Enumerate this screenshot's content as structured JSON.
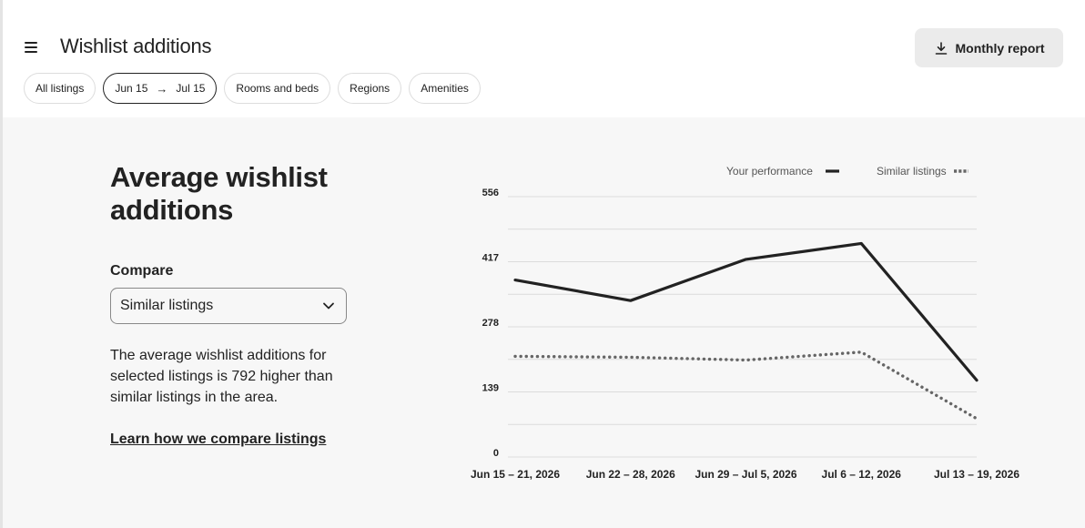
{
  "header": {
    "title": "Wishlist additions",
    "report_button": "Monthly report"
  },
  "filters": {
    "all_listings": "All listings",
    "date_from": "Jun 15",
    "date_to": "Jul 15",
    "rooms": "Rooms and beds",
    "regions": "Regions",
    "amenities": "Amenities"
  },
  "main": {
    "title": "Average wishlist additions",
    "compare_label": "Compare",
    "compare_value": "Similar listings",
    "description": "The average wishlist additions for selected listings is 792 higher than similar listings in the area.",
    "learn_link": "Learn how we compare listings"
  },
  "chart_data": {
    "type": "line",
    "categories": [
      "Jun 15 – 21, 2026",
      "Jun 22 – 28, 2026",
      "Jun 29 – Jul 5, 2026",
      "Jul 6 – 12, 2026",
      "Jul 13 – 19, 2026"
    ],
    "series": [
      {
        "name": "Your performance",
        "values": [
          378,
          334,
          422,
          456,
          164
        ],
        "style": "solid",
        "color": "#222222"
      },
      {
        "name": "Similar listings",
        "values": [
          215,
          213,
          207,
          224,
          82
        ],
        "style": "dotted",
        "color": "#666666"
      }
    ],
    "y_ticks": [
      0,
      139,
      278,
      417,
      556
    ],
    "ylim": [
      0,
      556
    ],
    "grid": true,
    "legend": "top-right"
  }
}
